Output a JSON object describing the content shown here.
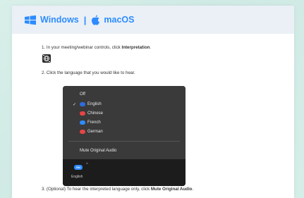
{
  "tabs": {
    "windows_label": "Windows",
    "separator": "|",
    "mac_label": "macOS"
  },
  "steps": {
    "step1_prefix": "1. In your meeting/webinar controls, click ",
    "step1_bold": "Interpretation",
    "step1_suffix": ".",
    "step2_text": "2. Click the language that you would like to hear.",
    "step3_prefix": "3. (Optional) To hear the interpreted language only, click ",
    "step3_bold": "Mute Original Audio",
    "step3_suffix": "."
  },
  "menu": {
    "off_label": "Off",
    "selected_checkmark": "✓",
    "languages": [
      {
        "label": "English",
        "color": "#2d6cdf"
      },
      {
        "label": "Chinese",
        "color": "#e64545"
      },
      {
        "label": "French",
        "color": "#2d8cff"
      },
      {
        "label": "German",
        "color": "#e64545"
      }
    ],
    "mute_label": "Mute Original Audio"
  },
  "toolbar": {
    "badge_text": "EN",
    "caret": "^",
    "label": "English"
  },
  "colors": {
    "accent": "#2d8cff",
    "background": "#d9efe9",
    "tab_bar": "#eaf0f6",
    "menu_bg": "#3a3a3a",
    "toolbar_bg": "#1c1c1c"
  },
  "icons": {
    "windows": "windows-logo-icon",
    "apple": "apple-logo-icon",
    "interpretation": "globe-interpretation-icon",
    "check": "checkmark-icon"
  }
}
